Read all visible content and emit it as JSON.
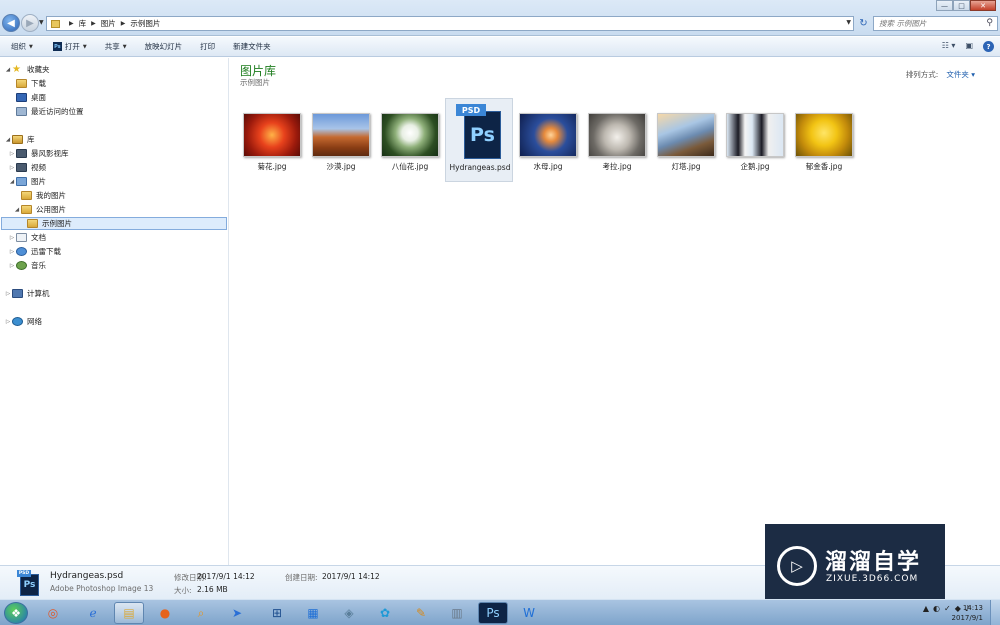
{
  "window": {
    "breadcrumb": [
      "库",
      "图片",
      "示例图片"
    ],
    "search_placeholder": "搜索 示例图片",
    "controls": {
      "minimize": "—",
      "maximize": "□",
      "close": "✕"
    }
  },
  "toolbar": {
    "organize": "组织",
    "open": "打开",
    "share": "共享",
    "slideshow": "放映幻灯片",
    "print": "打印",
    "new_folder": "新建文件夹"
  },
  "sidebar": {
    "favorites": "收藏夹",
    "downloads": "下载",
    "desktop": "桌面",
    "recent": "最近访问的位置",
    "libraries": "库",
    "baofeng": "暴风影视库",
    "videos": "视频",
    "pictures": "图片",
    "my_pictures": "我的图片",
    "public_pictures": "公用图片",
    "sample_pictures": "示例图片",
    "documents": "文档",
    "xunlei": "迅雷下载",
    "music": "音乐",
    "computer": "计算机",
    "network": "网络"
  },
  "main": {
    "title": "图片库",
    "subtitle": "示例图片",
    "arrange_label": "排列方式:",
    "arrange_value": "文件夹",
    "files": [
      {
        "name": "菊花.jpg"
      },
      {
        "name": "沙漠.jpg"
      },
      {
        "name": "八仙花.jpg"
      },
      {
        "name": "Hydrangeas.psd",
        "selected": true
      },
      {
        "name": "水母.jpg"
      },
      {
        "name": "考拉.jpg"
      },
      {
        "name": "灯塔.jpg"
      },
      {
        "name": "企鹅.jpg"
      },
      {
        "name": "郁金香.jpg"
      }
    ]
  },
  "details": {
    "icon_tag": "PSD",
    "icon_text": "Ps",
    "name": "Hydrangeas.psd",
    "type": "Adobe Photoshop Image 13",
    "modified_label": "修改日期:",
    "modified_value": "2017/9/1 14:12",
    "created_label": "创建日期:",
    "created_value": "2017/9/1 14:12",
    "size_label": "大小:",
    "size_value": "2.16 MB"
  },
  "big_icon": {
    "tag": "PSD",
    "text": "Ps"
  },
  "watermark": {
    "title": "溜溜自学",
    "subtitle": "ZIXUE.3D66.COM"
  },
  "taskbar": {
    "time": "14:13",
    "date": "2017/9/1"
  }
}
